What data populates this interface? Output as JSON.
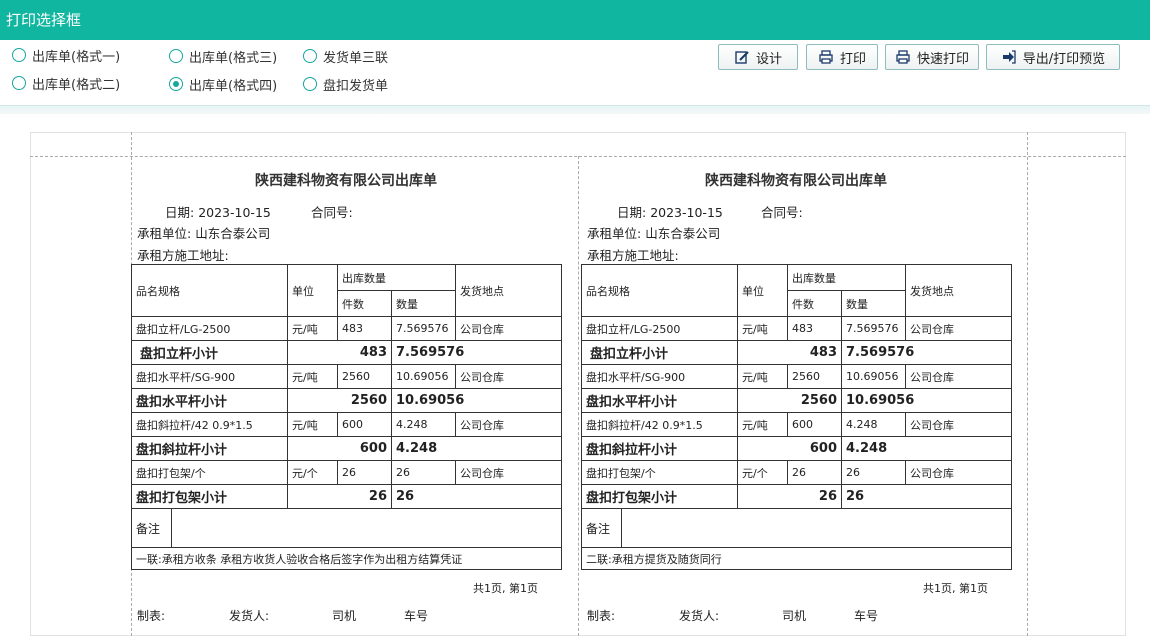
{
  "window": {
    "title": "打印选择框"
  },
  "options": [
    {
      "label": "出库单(格式一)",
      "selected": false
    },
    {
      "label": "出库单(格式二)",
      "selected": false
    },
    {
      "label": "出库单(格式三)",
      "selected": false
    },
    {
      "label": "出库单(格式四)",
      "selected": true
    },
    {
      "label": "发货单三联",
      "selected": false
    },
    {
      "label": "盘扣发货单",
      "selected": false
    }
  ],
  "toolbar": {
    "design_label": "设计",
    "print_label": "打印",
    "quick_print_label": "快速打印",
    "export_label": "导出/打印预览"
  },
  "slips": [
    {
      "title": "陕西建科物资有限公司出库单",
      "date_label": "日期:",
      "date": "2023-10-15",
      "contract_label": "合同号:",
      "lessee_label": "承租单位:",
      "lessee": "山东合泰公司",
      "site_label": "承租方施工地址:",
      "headers": {
        "spec": "品名规格",
        "unit": "单位",
        "qty": "出库数量",
        "pieces": "件数",
        "amount": "数量",
        "place": "发货地点"
      },
      "rows": [
        {
          "spec": "盘扣立杆/LG-2500",
          "unit": "元/吨",
          "pieces": "483",
          "amount": "7.569576",
          "place": "公司仓库",
          "sub_label": "盘扣立杆小计",
          "sub_pieces": "483",
          "sub_amount": "7.569576"
        },
        {
          "spec": "盘扣水平杆/SG-900",
          "unit": "元/吨",
          "pieces": "2560",
          "amount": "10.69056",
          "place": "公司仓库",
          "sub_label": "盘扣水平杆小计",
          "sub_pieces": "2560",
          "sub_amount": "10.69056"
        },
        {
          "spec": "盘扣斜拉杆/42  0.9*1.5",
          "unit": "元/吨",
          "pieces": "600",
          "amount": "4.248",
          "place": "公司仓库",
          "sub_label": "盘扣斜拉杆小计",
          "sub_pieces": "600",
          "sub_amount": "4.248"
        },
        {
          "spec": "盘扣打包架/个",
          "unit": "元/个",
          "pieces": "26",
          "amount": "26",
          "place": "公司仓库",
          "sub_label": "盘扣打包架小计",
          "sub_pieces": "26",
          "sub_amount": "26"
        }
      ],
      "remark_label": "备注",
      "note": "一联:承租方收条 承租方收货人验收合格后签字作为出租方结算凭证",
      "page": "共1页, 第1页",
      "maker": "制表:",
      "shipper": "发货人:",
      "driver": "司机",
      "plate": "车号"
    },
    {
      "title": "陕西建科物资有限公司出库单",
      "date_label": "日期:",
      "date": "2023-10-15",
      "contract_label": "合同号:",
      "lessee_label": "承租单位:",
      "lessee": "山东合泰公司",
      "site_label": "承租方施工地址:",
      "headers": {
        "spec": "品名规格",
        "unit": "单位",
        "qty": "出库数量",
        "pieces": "件数",
        "amount": "数量",
        "place": "发货地点"
      },
      "rows": [
        {
          "spec": "盘扣立杆/LG-2500",
          "unit": "元/吨",
          "pieces": "483",
          "amount": "7.569576",
          "place": "公司仓库",
          "sub_label": "盘扣立杆小计",
          "sub_pieces": "483",
          "sub_amount": "7.569576"
        },
        {
          "spec": "盘扣水平杆/SG-900",
          "unit": "元/吨",
          "pieces": "2560",
          "amount": "10.69056",
          "place": "公司仓库",
          "sub_label": "盘扣水平杆小计",
          "sub_pieces": "2560",
          "sub_amount": "10.69056"
        },
        {
          "spec": "盘扣斜拉杆/42  0.9*1.5",
          "unit": "元/吨",
          "pieces": "600",
          "amount": "4.248",
          "place": "公司仓库",
          "sub_label": "盘扣斜拉杆小计",
          "sub_pieces": "600",
          "sub_amount": "4.248"
        },
        {
          "spec": "盘扣打包架/个",
          "unit": "元/个",
          "pieces": "26",
          "amount": "26",
          "place": "公司仓库",
          "sub_label": "盘扣打包架小计",
          "sub_pieces": "26",
          "sub_amount": "26"
        }
      ],
      "remark_label": "备注",
      "note": "二联:承租方提货及随货同行",
      "page": "共1页, 第1页",
      "maker": "制表:",
      "shipper": "发货人:",
      "driver": "司机",
      "plate": "车号"
    }
  ]
}
